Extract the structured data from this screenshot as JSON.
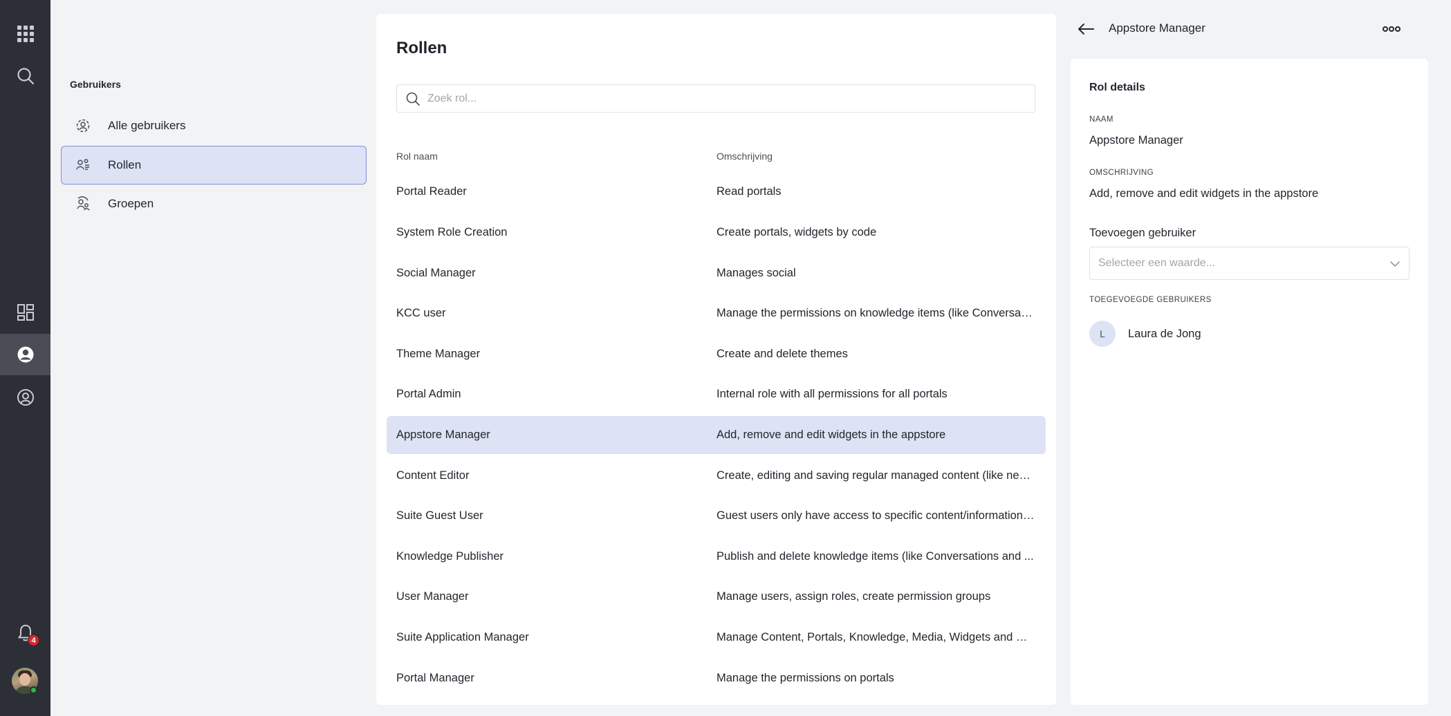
{
  "rail": {
    "notification_count": "4"
  },
  "subnav": {
    "title": "Gebruikers",
    "items": [
      {
        "label": "Alle gebruikers",
        "icon": "users-circle-icon"
      },
      {
        "label": "Rollen",
        "icon": "roles-icon"
      },
      {
        "label": "Groepen",
        "icon": "groups-icon"
      }
    ]
  },
  "roles": {
    "title": "Rollen",
    "search_placeholder": "Zoek rol...",
    "col_name": "Rol naam",
    "col_desc": "Omschrijving",
    "rows": [
      {
        "name": "Portal Reader",
        "desc": "Read portals"
      },
      {
        "name": "System Role Creation",
        "desc": "Create portals, widgets by code"
      },
      {
        "name": "Social Manager",
        "desc": "Manages social"
      },
      {
        "name": "KCC user",
        "desc": "Manage the permissions on knowledge items (like Conversations and ..."
      },
      {
        "name": "Theme Manager",
        "desc": "Create and delete themes"
      },
      {
        "name": "Portal Admin",
        "desc": "Internal role with all permissions for all portals"
      },
      {
        "name": "Appstore Manager",
        "desc": "Add, remove and edit widgets in the appstore"
      },
      {
        "name": "Content Editor",
        "desc": "Create, editing and saving regular managed content (like news, ..."
      },
      {
        "name": "Suite Guest User",
        "desc": "Guest users only have access to specific content/information ..."
      },
      {
        "name": "Knowledge Publisher",
        "desc": "Publish and delete knowledge items (like Conversations and ..."
      },
      {
        "name": "User Manager",
        "desc": "Manage users, assign roles, create permission groups"
      },
      {
        "name": "Suite Application Manager",
        "desc": "Manage Content, Portals, Knowledge, Media, Widgets and Users ..."
      },
      {
        "name": "Portal Manager",
        "desc": "Manage the permissions on portals"
      }
    ]
  },
  "detail": {
    "header_title": "Appstore Manager",
    "card_title": "Rol details",
    "name_label": "NAAM",
    "name_value": "Appstore Manager",
    "desc_label": "OMSCHRIJVING",
    "desc_value": "Add, remove and edit widgets in the appstore",
    "add_user_label": "Toevoegen gebruiker",
    "select_placeholder": "Selecteer een waarde...",
    "added_users_label": "TOEGEVOEGDE GEBRUIKERS",
    "added_users": [
      {
        "initial": "L",
        "name": "Laura de Jong"
      }
    ]
  },
  "colors": {
    "rail_bg": "#2c2f36",
    "selected_bg": "#dde3f5",
    "selected_border": "#7e8fd6",
    "badge": "#d8262c"
  }
}
